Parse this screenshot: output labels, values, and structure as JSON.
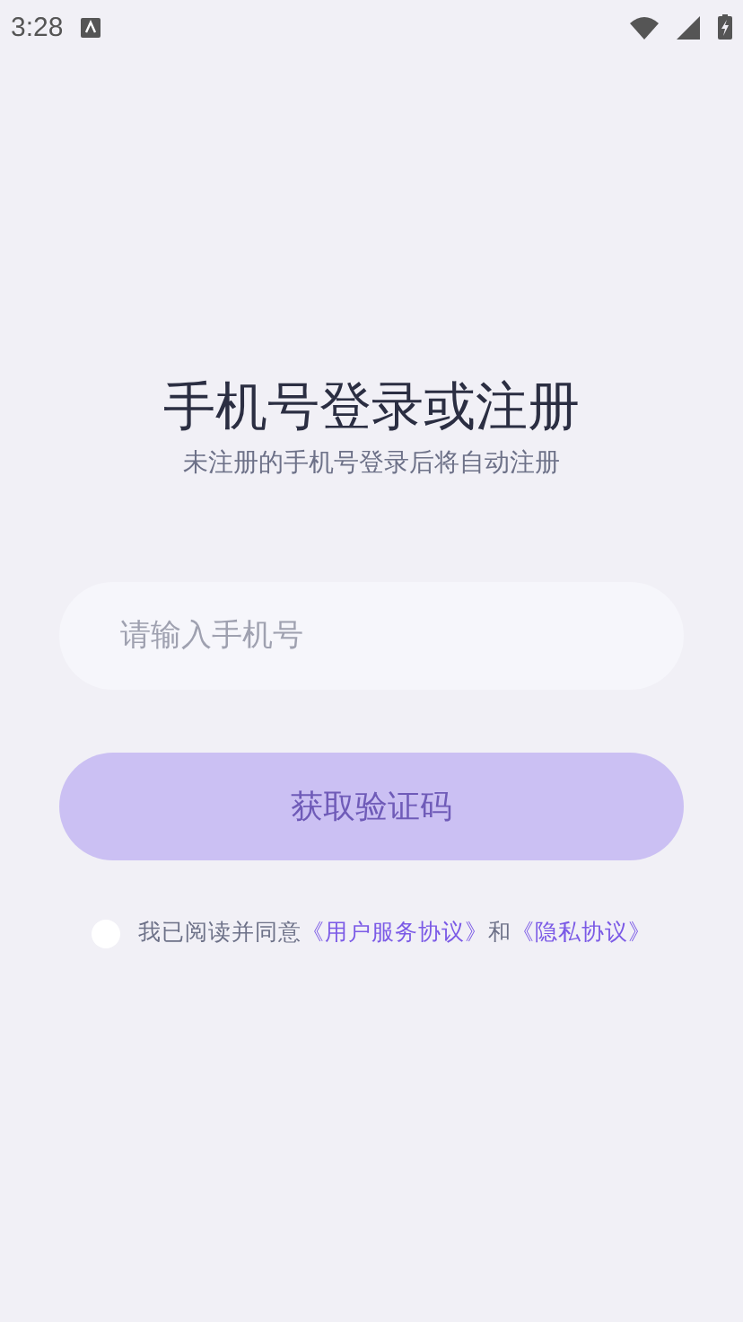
{
  "status_bar": {
    "time": "3:28"
  },
  "title": "手机号登录或注册",
  "subtitle": "未注册的手机号登录后将自动注册",
  "phone_field": {
    "placeholder": "请输入手机号"
  },
  "submit_button": {
    "label": "获取验证码",
    "disabled": true
  },
  "agreement": {
    "checked": false,
    "parts": [
      {
        "kind": "text",
        "text": "我已阅读并同意"
      },
      {
        "kind": "link",
        "text": "《用户服务协议》"
      },
      {
        "kind": "text",
        "text": "和"
      },
      {
        "kind": "link",
        "text": "《隐私协议》"
      }
    ]
  }
}
